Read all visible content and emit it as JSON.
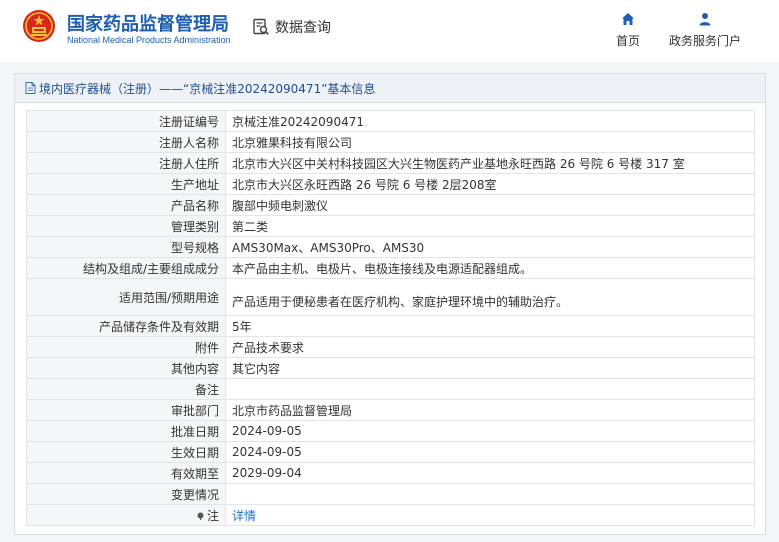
{
  "header": {
    "site_title_cn": "国家药品监督管理局",
    "site_title_en": "National Medical Products Administration",
    "query_label": "数据查询",
    "nav": {
      "home_label": "首页",
      "service_label": "政务服务门户"
    }
  },
  "panel": {
    "title": "境内医疗器械（注册）——“京械注准20242090471”基本信息"
  },
  "rows": [
    {
      "label": "注册证编号",
      "value": "京械注准20242090471"
    },
    {
      "label": "注册人名称",
      "value": "北京雅果科技有限公司"
    },
    {
      "label": "注册人住所",
      "value": "北京市大兴区中关村科技园区大兴生物医药产业基地永旺西路 26 号院 6 号楼 317 室"
    },
    {
      "label": "生产地址",
      "value": "北京市大兴区永旺西路 26 号院 6 号楼 2层208室"
    },
    {
      "label": "产品名称",
      "value": "腹部中频电刺激仪"
    },
    {
      "label": "管理类别",
      "value": "第二类"
    },
    {
      "label": "型号规格",
      "value": "AMS30Max、AMS30Pro、AMS30"
    },
    {
      "label": "结构及组成/主要组成成分",
      "value": "本产品由主机、电极片、电极连接线及电源适配器组成。"
    },
    {
      "label": "适用范围/预期用途",
      "value": "产品适用于便秘患者在医疗机构、家庭护理环境中的辅助治疗。"
    },
    {
      "label": "产品储存条件及有效期",
      "value": "5年"
    },
    {
      "label": "附件",
      "value": "产品技术要求"
    },
    {
      "label": "其他内容",
      "value": "其它内容"
    },
    {
      "label": "备注",
      "value": ""
    },
    {
      "label": "审批部门",
      "value": "北京市药品监督管理局"
    },
    {
      "label": "批准日期",
      "value": "2024-09-05"
    },
    {
      "label": "生效日期",
      "value": "2024-09-05"
    },
    {
      "label": "有效期至",
      "value": "2029-09-04"
    },
    {
      "label": "变更情况",
      "value": ""
    },
    {
      "label": "注",
      "value": "详情"
    }
  ],
  "colors": {
    "brand_blue": "#1f5fb0",
    "link_blue": "#1f6fc4",
    "emblem_red": "#d7261d",
    "emblem_gold": "#f2c230"
  },
  "icons": {
    "emblem": "national-emblem-icon",
    "query": "data-query-icon",
    "home": "home-icon",
    "service": "user-icon",
    "panel": "document-icon",
    "note": "note-bullet-icon"
  }
}
